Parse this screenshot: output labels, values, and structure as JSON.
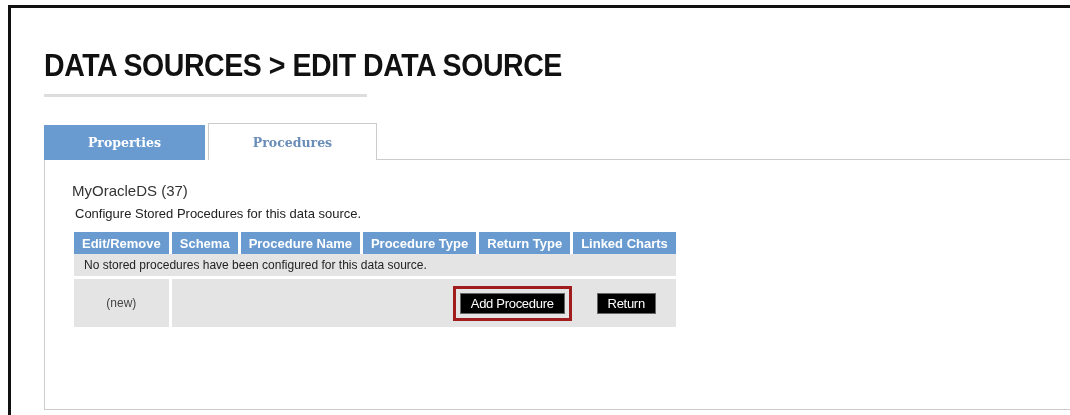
{
  "page": {
    "title": "DATA SOURCES > EDIT DATA SOURCE"
  },
  "tabs": [
    {
      "label": "Properties",
      "selected": false
    },
    {
      "label": "Procedures",
      "selected": true
    }
  ],
  "data_source": {
    "name": "MyOracleDS (37)",
    "description": "Configure Stored Procedures for this data source."
  },
  "table": {
    "columns": [
      "Edit/Remove",
      "Schema",
      "Procedure Name",
      "Procedure Type",
      "Return Type",
      "Linked Charts"
    ],
    "empty_message": "No stored procedures have been configured for this data source.",
    "new_row": {
      "label": "(new)",
      "buttons": [
        {
          "label": "Add Procedure",
          "highlighted": true
        },
        {
          "label": "Return",
          "highlighted": false
        }
      ]
    }
  }
}
